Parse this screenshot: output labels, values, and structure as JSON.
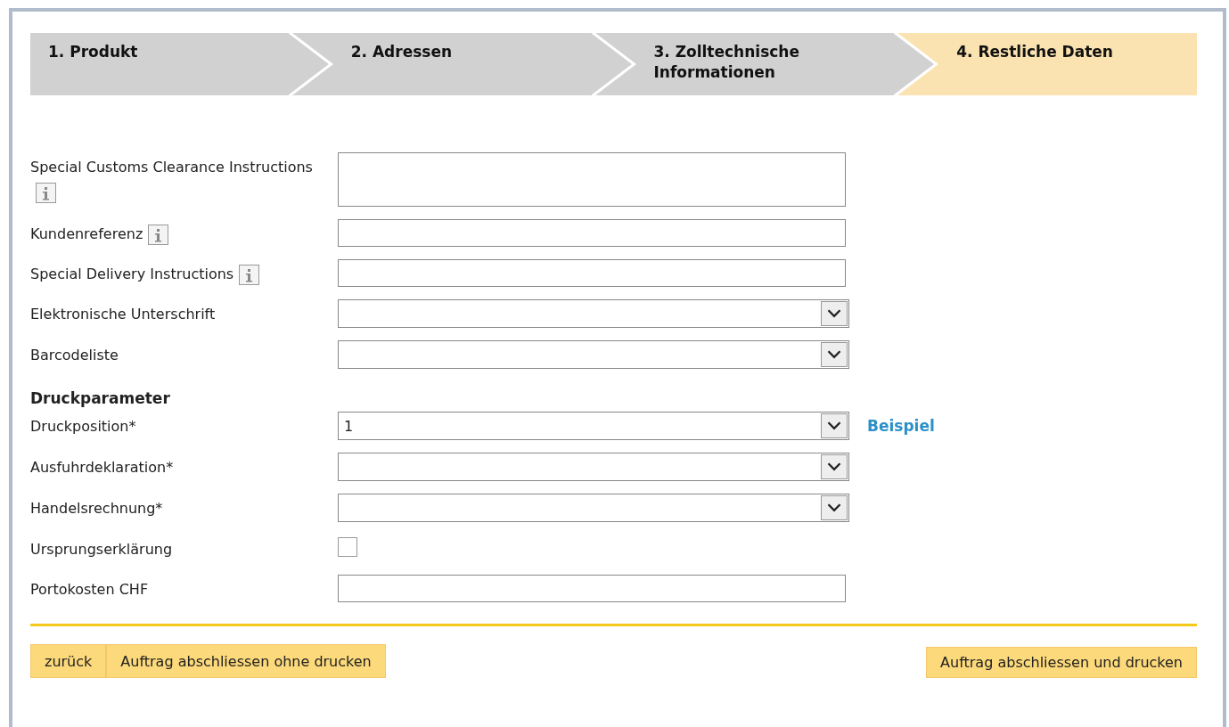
{
  "steps": [
    {
      "label": "1. Produkt",
      "selected": false
    },
    {
      "label": "2. Adressen",
      "selected": false
    },
    {
      "label": "3. Zolltechnische Informationen",
      "selected": false
    },
    {
      "label": "4. Restliche Daten",
      "selected": true
    }
  ],
  "form": [
    {
      "kind": "textarea",
      "label": "Special Customs Clearance Instructions",
      "info": true
    },
    {
      "kind": "text",
      "label": "Kundenreferenz",
      "info": true
    },
    {
      "kind": "text",
      "label": "Special Delivery Instructions",
      "info": true
    },
    {
      "kind": "select",
      "label": "Elektronische Unterschrift"
    },
    {
      "kind": "select",
      "label": "Barcodeliste"
    },
    {
      "kind": "heading",
      "label": "Druckparameter"
    },
    {
      "kind": "select",
      "label": "Druckposition*",
      "value": "1",
      "link": "Beispiel"
    },
    {
      "kind": "select",
      "label": "Ausfuhrdeklaration*"
    },
    {
      "kind": "select",
      "label": "Handelsrechnung*"
    },
    {
      "kind": "checkbox",
      "label": "Ursprungserklärung",
      "checked": false
    },
    {
      "kind": "text",
      "label": "Portokosten CHF"
    }
  ],
  "buttons_left": [
    "zurück",
    "Auftrag abschliessen ohne drucken"
  ],
  "buttons_right": [
    "Auftrag abschliessen und drucken"
  ]
}
